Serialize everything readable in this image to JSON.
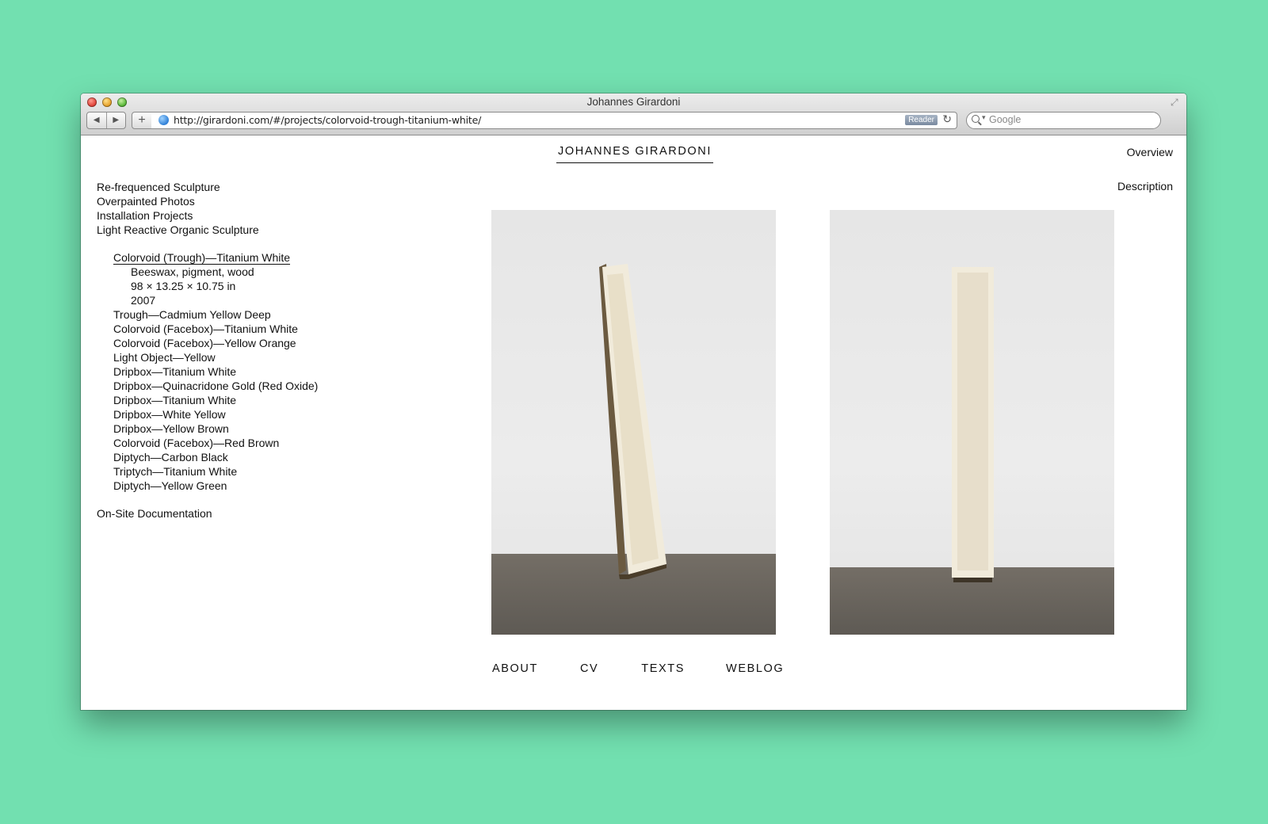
{
  "browser": {
    "title": "Johannes Girardoni",
    "url": "http://girardoni.com/#/projects/colorvoid-trough-titanium-white/",
    "reader_label": "Reader",
    "search_placeholder": "Google",
    "nav_back": "◀",
    "nav_forward": "▶",
    "add_button": "+"
  },
  "site": {
    "title": "JOHANNES GIRARDONI",
    "overview": "Overview",
    "description": "Description"
  },
  "sidebar": {
    "categories_top": [
      "Re-frequenced Sculpture",
      "Overpainted Photos",
      "Installation Projects",
      "Light Reactive Organic Sculpture"
    ],
    "active_project": "Colorvoid (Trough)—Titanium White",
    "active_details": [
      "Beeswax, pigment, wood",
      "98 × 13.25 × 10.75 in",
      "2007"
    ],
    "projects": [
      "Trough—Cadmium Yellow Deep",
      "Colorvoid (Facebox)—Titanium White",
      "Colorvoid (Facebox)—Yellow Orange",
      "Light Object—Yellow",
      "Dripbox—Titanium White",
      "Dripbox—Quinacridone Gold (Red Oxide)",
      "Dripbox—Titanium White",
      "Dripbox—White Yellow",
      "Dripbox—Yellow Brown",
      "Colorvoid (Facebox)—Red Brown",
      "Diptych—Carbon Black",
      "Triptych—Titanium White",
      "Diptych—Yellow Green"
    ],
    "category_bottom": "On-Site Documentation"
  },
  "footer": {
    "links": [
      "ABOUT",
      "CV",
      "TEXTS",
      "WEBLOG"
    ]
  },
  "colors": {
    "background": "#72e0b0",
    "text": "#111111"
  }
}
